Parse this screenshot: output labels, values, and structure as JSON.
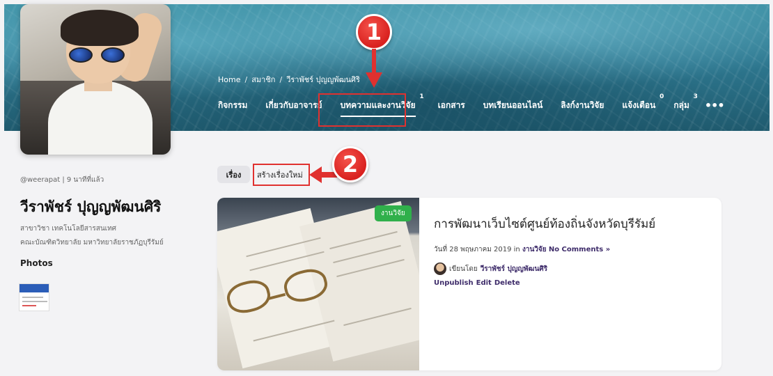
{
  "breadcrumb": {
    "home": "Home",
    "sep1": "/",
    "members": "สมาชิก",
    "sep2": "/",
    "current": "วีราพัชร์ ปุญญพัฒนศิริ"
  },
  "nav": {
    "items": [
      {
        "label": "กิจกรรม"
      },
      {
        "label": "เกี่ยวกับอาจารย์"
      },
      {
        "label": "บทความและงานวิจัย",
        "badge": "1",
        "active": true
      },
      {
        "label": "เอกสาร"
      },
      {
        "label": "บทเรียนออนไลน์"
      },
      {
        "label": "ลิงก์งานวิจัย"
      },
      {
        "label": "แจ้งเตือน",
        "badge": "0"
      },
      {
        "label": "กลุ่ม",
        "badge": "3"
      }
    ],
    "more": "•••"
  },
  "annotations": {
    "step1": "1",
    "step2": "2",
    "color": "#e0312f"
  },
  "profile": {
    "handle": "@weerapat",
    "divider": "|",
    "last_active": "9 นาทีที่แล้ว",
    "name": "วีราพัชร์ ปุญญพัฒนศิริ",
    "major": "สาขาวิชา เทคโนโลยีสารสนเทศ",
    "faculty": "คณะบัณฑิตวิทยาลัย มหาวิทยาลัยราชภัฏบุรีรัมย์",
    "photos_title": "Photos"
  },
  "tabs": {
    "story": "เรื่อง",
    "new_story": "สร้างเรื่องใหม่"
  },
  "post": {
    "category_badge": "งานวิจัย",
    "title": "การพัฒนาเว็บไซต์ศูนย์ท้องถิ่นจังหวัดบุรีรัมย์",
    "date_prefix": "วันที่ 28 พฤษภาคม 2019 in",
    "category_link": "งานวิจัย",
    "comments": "No Comments »",
    "author_prefix": "เขียนโดย",
    "author_name": "วีราพัชร์ ปุญญพัฒนศิริ",
    "actions": [
      "Unpublish",
      "Edit",
      "Delete"
    ],
    "badge_color": "#30b04b",
    "link_color": "#3e2c6a"
  }
}
